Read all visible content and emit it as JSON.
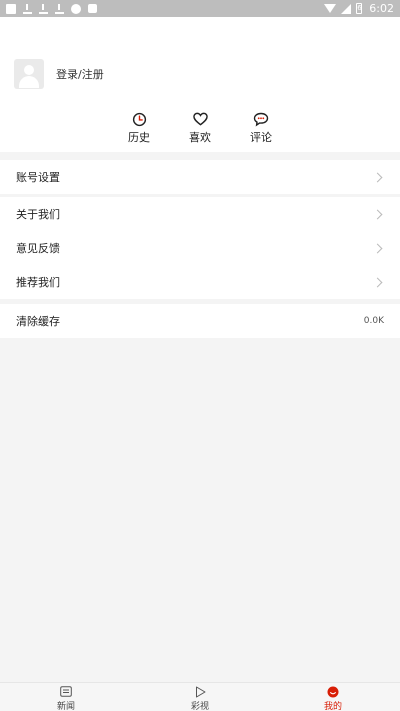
{
  "status_bar": {
    "time": "6:02",
    "battery_level": "6"
  },
  "profile": {
    "login_label": "登录/注册"
  },
  "quick_actions": [
    {
      "label": "历史",
      "icon": "clock-icon"
    },
    {
      "label": "喜欢",
      "icon": "heart-icon"
    },
    {
      "label": "评论",
      "icon": "comment-icon"
    }
  ],
  "menu": {
    "account_settings": "账号设置",
    "about_us": "关于我们",
    "feedback": "意见反馈",
    "recommend": "推荐我们",
    "clear_cache": "清除缓存",
    "cache_size": "0.0K"
  },
  "bottom_nav": [
    {
      "label": "新闻",
      "icon": "news-icon",
      "active": false
    },
    {
      "label": "彩视",
      "icon": "play-icon",
      "active": false
    },
    {
      "label": "我的",
      "icon": "profile-icon",
      "active": true
    }
  ],
  "colors": {
    "accent": "#d81e06",
    "status_bar": "#bdbdbd",
    "background": "#f4f4f4"
  }
}
